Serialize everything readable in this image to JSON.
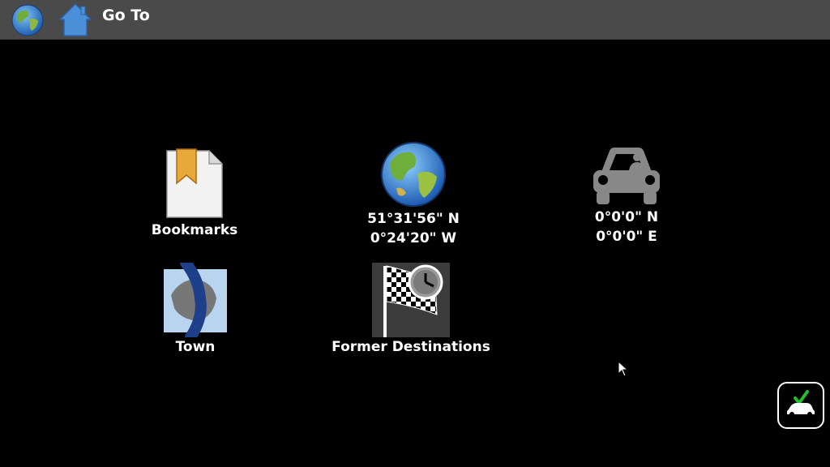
{
  "header": {
    "title": "Go To",
    "globe_icon": "globe-icon",
    "home_icon": "home-icon"
  },
  "tiles": {
    "bookmarks": {
      "label": "Bookmarks",
      "icon": "bookmark-document-icon"
    },
    "coordinates": {
      "lat": "51°31'56\" N",
      "lon": "0°24'20\" W",
      "icon": "globe-icon"
    },
    "vehicle_position": {
      "lat": "0°0'0\" N",
      "lon": "0°0'0\" E",
      "icon": "car-icon"
    },
    "town": {
      "label": "Town",
      "icon": "town-map-icon"
    },
    "former_destinations": {
      "label": "Former Destinations",
      "icon": "checkered-flag-clock-icon"
    }
  },
  "footer": {
    "confirm_icon": "car-check-icon"
  },
  "colors": {
    "header_bg": "#4a4a4a",
    "background": "#000000",
    "check_green": "#22c02a",
    "home_blue": "#4a8fd8"
  }
}
